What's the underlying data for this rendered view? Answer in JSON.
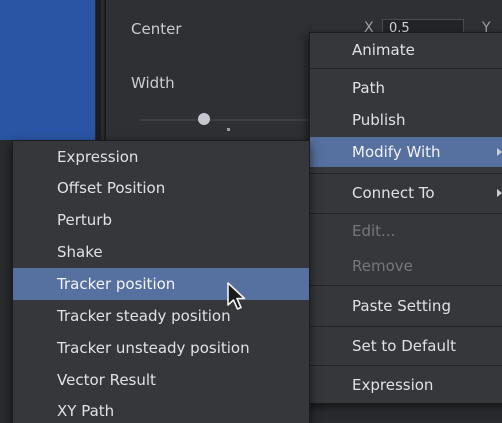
{
  "inspector": {
    "center_label": "Center",
    "width_label": "Width",
    "center_x_axis": "X",
    "center_x_value": "0.5",
    "center_y_axis": "Y"
  },
  "context_menu": {
    "items": [
      {
        "label": "Animate",
        "state": "normal"
      },
      {
        "label": "Path",
        "state": "normal"
      },
      {
        "label": "Publish",
        "state": "normal"
      },
      {
        "label": "Modify With",
        "state": "highlighted",
        "submenu": true
      },
      {
        "label": "Connect To",
        "state": "normal",
        "submenu": true
      },
      {
        "label": "Edit...",
        "state": "disabled"
      },
      {
        "label": "Remove",
        "state": "disabled"
      },
      {
        "label": "Paste Setting",
        "state": "normal"
      },
      {
        "label": "Set to Default",
        "state": "normal"
      },
      {
        "label": "Expression",
        "state": "normal"
      }
    ]
  },
  "submenu": {
    "items": [
      {
        "label": "Expression"
      },
      {
        "label": "Offset Position"
      },
      {
        "label": "Perturb"
      },
      {
        "label": "Shake"
      },
      {
        "label": "Tracker position",
        "state": "highlighted"
      },
      {
        "label": "Tracker steady position"
      },
      {
        "label": "Tracker unsteady position"
      },
      {
        "label": "Vector Result"
      },
      {
        "label": "XY Path"
      }
    ]
  },
  "colors": {
    "viewer_blue": "#2a55a4",
    "menu_bg": "#36373b",
    "highlight": "#56709f",
    "text": "#dfe1e5",
    "disabled_text": "#75777c"
  },
  "icons": {
    "cursor": "arrow-cursor-icon",
    "submenu_arrow": "chevron-right-icon"
  }
}
